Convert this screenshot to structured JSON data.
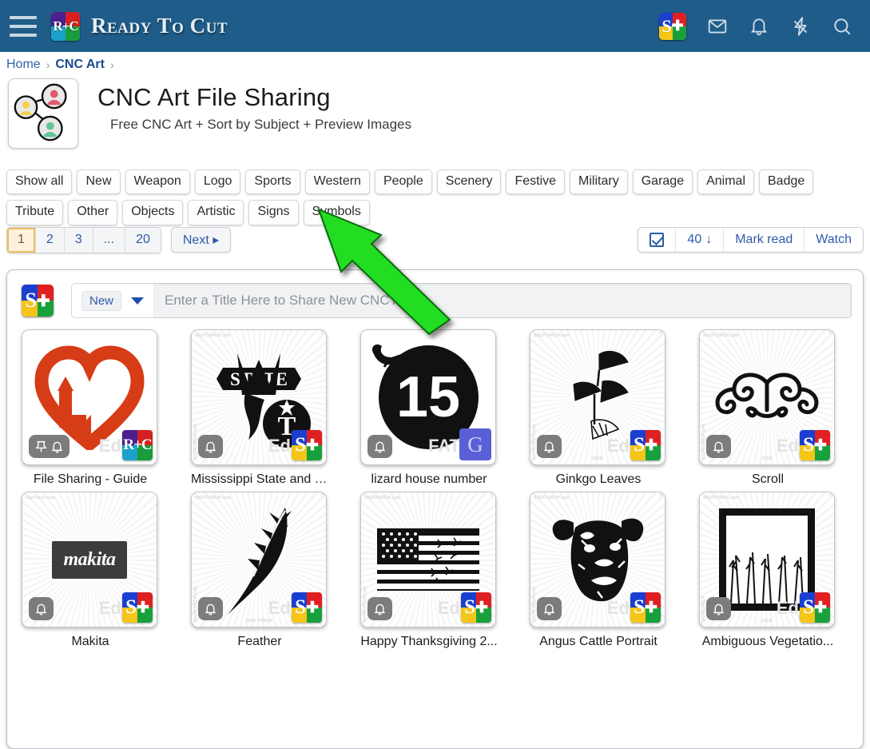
{
  "header": {
    "menu_icon": "hamburger-icon",
    "logo_text": "R+C",
    "brand_title": "Ready To Cut",
    "right_icons": [
      {
        "name": "st-logo-icon",
        "label": "ST"
      },
      {
        "name": "mail-icon",
        "label": "Mail"
      },
      {
        "name": "bell-icon",
        "label": "Notifications"
      },
      {
        "name": "lightning-icon",
        "label": "Activity"
      },
      {
        "name": "search-icon",
        "label": "Search"
      }
    ],
    "bar_color": "#1f5c89"
  },
  "breadcrumb": {
    "items": [
      {
        "label": "Home",
        "strong": false
      },
      {
        "label": "CNC Art",
        "strong": true
      }
    ],
    "separator": "›"
  },
  "page": {
    "icon": "share-network-icon",
    "title": "CNC Art File Sharing",
    "subtitle": "Free CNC Art + Sort by Subject + Preview Images"
  },
  "categories": [
    "Show all",
    "New",
    "Weapon",
    "Logo",
    "Sports",
    "Western",
    "People",
    "Scenery",
    "Festive",
    "Military",
    "Garage",
    "Animal",
    "Badge",
    "Tribute",
    "Other",
    "Objects",
    "Artistic",
    "Signs",
    "Symbols"
  ],
  "pagination": {
    "pages": [
      "1",
      "2",
      "3",
      "...",
      "20"
    ],
    "active_page": "1",
    "next_label": "Next",
    "next_arrow": "▸"
  },
  "list_controls": {
    "checkbox_checked": true,
    "per_page": "40",
    "per_page_arrow": "↓",
    "mark_read_label": "Mark read",
    "watch_label": "Watch"
  },
  "share_bar": {
    "logo": "st-logo-icon",
    "new_label": "New",
    "dropdown_icon": "caret-down-icon",
    "input_value": "",
    "input_placeholder": "Enter a Title Here to Share New CNC Art"
  },
  "annotation": {
    "type": "green-arrow",
    "color": "#22dd22",
    "points_to": "Symbols"
  },
  "cards": [
    {
      "title": "File Sharing - Guide",
      "art": "heart-recycle",
      "badges": [
        "pin-icon",
        "bell-icon"
      ],
      "corner_logo": "rtc-logo-icon",
      "watermark_ed": "Ed",
      "watermarks": []
    },
    {
      "title": "Mississippi State and T...",
      "art": "state-banner",
      "badges": [
        "bell-icon"
      ],
      "corner_logo": "st-logo-icon",
      "watermark_ed": "Ed",
      "watermarks": [
        "SIGHTORCH.com",
        "SIGHTORCH.com",
        "SIGHTORCH.com"
      ]
    },
    {
      "title": "lizard house number",
      "art": "lizard-15",
      "badges": [
        "bell-icon"
      ],
      "corner_logo": "g-badge",
      "watermark_ed": "FAT",
      "watermarks": []
    },
    {
      "title": "Ginkgo Leaves",
      "art": "ginkgo",
      "badges": [
        "bell-icon"
      ],
      "corner_logo": "st-logo-icon",
      "watermark_ed": "Ed",
      "watermarks": [
        "SIGHTORCH.com",
        "SIGHTORCH.com",
        "SIGHTORCH.com",
        "SIGN"
      ]
    },
    {
      "title": "Scroll",
      "art": "scroll",
      "badges": [
        "bell-icon"
      ],
      "corner_logo": "st-logo-icon",
      "watermark_ed": "Ed",
      "watermarks": [
        "SIGHTORCH.com",
        "SIGHTORCH.com",
        "SIGHTORCH.com",
        "SIGN"
      ]
    },
    {
      "title": "Makita",
      "art": "makita",
      "badges": [
        "bell-icon"
      ],
      "corner_logo": "st-logo-icon",
      "watermark_ed": "Ed",
      "watermarks": [
        "SignTorch.com"
      ]
    },
    {
      "title": "Feather",
      "art": "feather",
      "badges": [
        "bell-icon"
      ],
      "corner_logo": "st-logo-icon",
      "watermark_ed": "Ed",
      "watermarks": [
        "SIGHTORCH.com",
        "SIGHTORCH.com",
        "SIGHTORCH.com",
        "SIGN TORCH"
      ]
    },
    {
      "title": "Happy Thanksgiving 2...",
      "art": "usa-flag",
      "badges": [
        "bell-icon"
      ],
      "corner_logo": "st-logo-icon",
      "watermark_ed": "Ed",
      "watermarks": [
        "SIGHTORCH.com",
        "SIGHTORCH.com",
        "SIGHTORCH.com"
      ]
    },
    {
      "title": "Angus Cattle Portrait",
      "art": "angus-cow",
      "badges": [
        "bell-icon"
      ],
      "corner_logo": "st-logo-icon",
      "watermark_ed": "Ed",
      "watermarks": [
        "SIGHTORCH.com",
        "SIGHTORCH.com",
        "SIGHTORCH.com"
      ]
    },
    {
      "title": "Ambiguous Vegetatio...",
      "art": "vegetation-frame",
      "badges": [
        "bell-icon"
      ],
      "corner_logo": "st-logo-icon",
      "watermark_ed": "Ed",
      "watermarks": [
        "SIGHTORCH.com",
        "SIGHTORCH.com",
        "SIGHTORCH",
        "SIGN"
      ]
    }
  ]
}
